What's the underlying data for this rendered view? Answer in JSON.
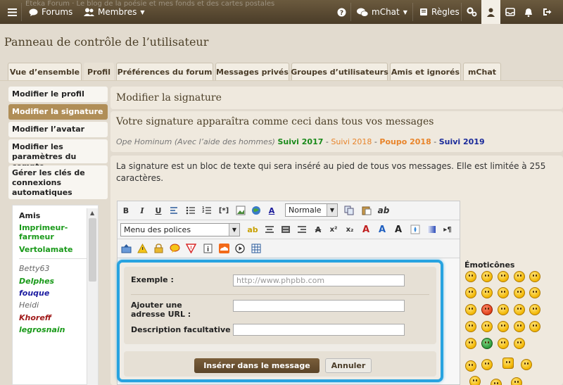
{
  "nav": {
    "ghost_text": "Eteka Forum · Le blog de la poésie et mes fonds et des cartes postales",
    "forums": "Forums",
    "members": "Membres",
    "mchat": "mChat",
    "rules": "Règles"
  },
  "page_title": "Panneau de contrôle de l’utilisateur",
  "tabs": [
    "Vue d’ensemble",
    "Profil",
    "Préférences du forum",
    "Messages privés",
    "Groupes d’utilisateurs",
    "Amis et ignorés",
    "mChat"
  ],
  "menu": [
    "Modifier le profil",
    "Modifier la signature",
    "Modifier l’avatar",
    "Modifier les paramètres du compte",
    "Gérer les clés de connexions automatiques"
  ],
  "friends": {
    "header": "Amis",
    "online": [
      {
        "name": "Imprimeur-farmeur",
        "color": "#1a9a1a"
      },
      {
        "name": "Vertolamate",
        "color": "#1a9a1a"
      }
    ],
    "offline": [
      {
        "name": "Betty63",
        "color": "#666666",
        "style": "italic"
      },
      {
        "name": "Delphes",
        "color": "#1a9a1a",
        "style": "bold-italic"
      },
      {
        "name": "fouque",
        "color": "#1a1aa0",
        "style": "bold-italic"
      },
      {
        "name": "Heidi",
        "color": "#666666",
        "style": "italic"
      },
      {
        "name": "Khoreff",
        "color": "#a01a1a",
        "style": "bold-italic"
      },
      {
        "name": "legrosnain",
        "color": "#1a9a1a",
        "style": "bold-italic"
      }
    ]
  },
  "section_title": "Modifier la signature",
  "preview": {
    "title": "Votre signature apparaîtra comme ceci dans tous vos messages",
    "prefix": "Ope Hominum (Avec l’aide des hommes)",
    "parts": [
      {
        "text": "Suivi 2017",
        "color": "#1a8a1a"
      },
      {
        "text": " - ",
        "color": "#555555"
      },
      {
        "text": "Suivi 2018",
        "color": "#e8842a"
      },
      {
        "text": " - ",
        "color": "#555555"
      },
      {
        "text": "Poupo 2018",
        "color": "#e8842a"
      },
      {
        "text": " - ",
        "color": "#555555"
      },
      {
        "text": "Suivi 2019",
        "color": "#1a2a9a"
      }
    ]
  },
  "description": "La signature est un bloc de texte qui sera inséré au pied de tous vos messages. Elle est limitée à 255 caractères.",
  "editor": {
    "size_select": "Normale",
    "font_select": "Menu des polices",
    "bold": "B",
    "italic": "I",
    "underline": "U",
    "ab": "ab"
  },
  "emoticons_title": "Émoticônes",
  "dialog": {
    "example_label": "Exemple :",
    "url_label": "Ajouter une adresse URL :",
    "desc_label": "Description facultative :",
    "url_placeholder": "http://www.phpbb.com",
    "insert_button": "Insérer dans le message",
    "cancel_button": "Annuler"
  },
  "colors": {
    "accent": "#27a3e0",
    "brand": "#5a4428"
  }
}
